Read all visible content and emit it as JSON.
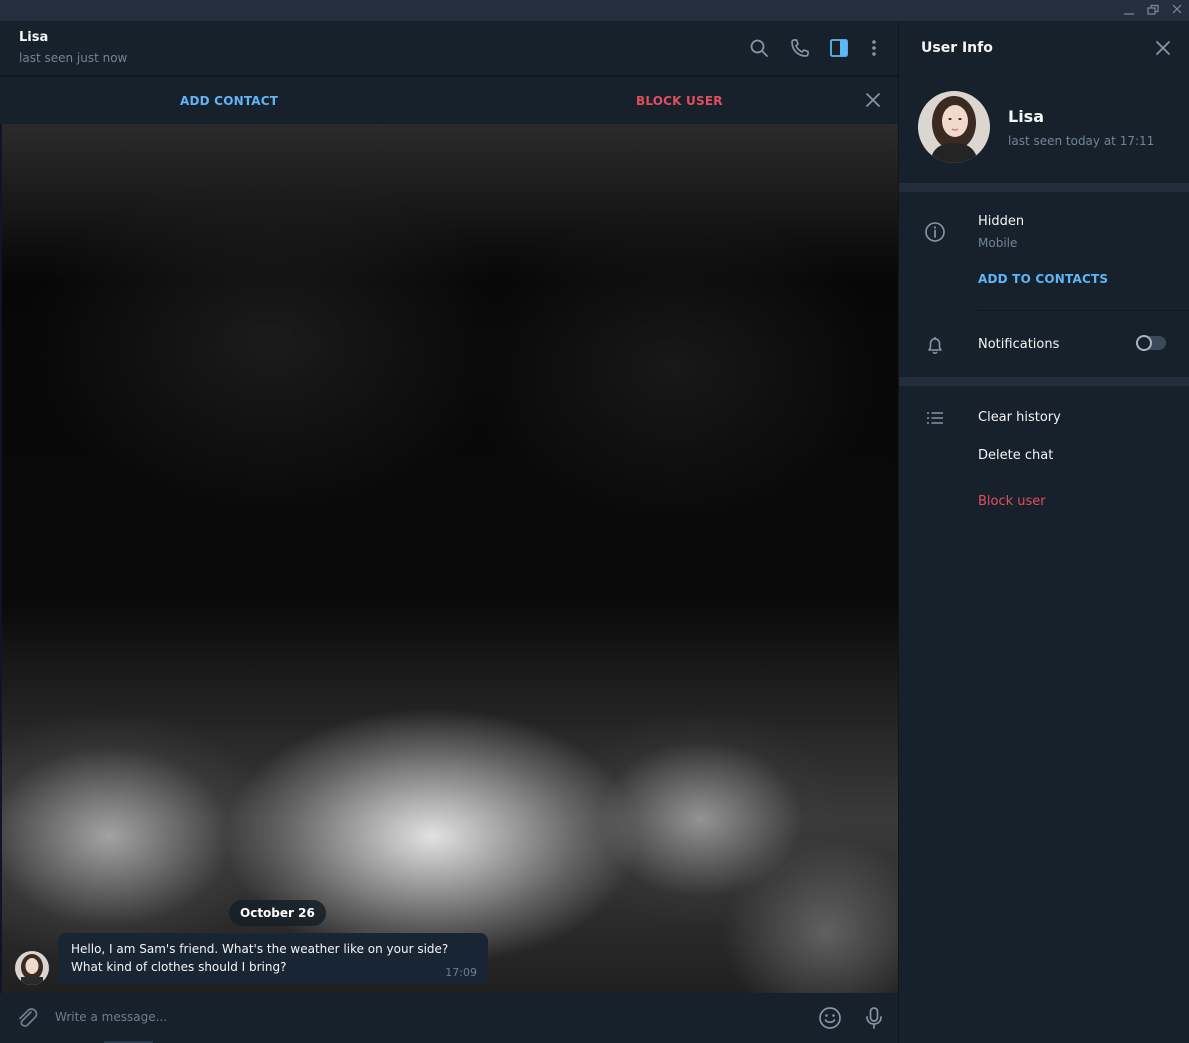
{
  "window": {
    "controls": [
      "minimize-icon",
      "restore-icon",
      "close-icon"
    ]
  },
  "chat": {
    "name": "Lisa",
    "status": "last seen just now",
    "header_icons": [
      "search-icon",
      "phone-icon",
      "sidebar-toggle-icon",
      "more-vertical-icon"
    ],
    "action_bar": {
      "add_contact": "ADD CONTACT",
      "block_user": "BLOCK USER"
    },
    "date_separator": "October 26",
    "messages": [
      {
        "text": "Hello, I am Sam's friend. What's the weather like on your side? What kind of clothes should I bring?",
        "time": "17:09"
      }
    ],
    "composer": {
      "placeholder": "Write a message..."
    }
  },
  "user_info": {
    "title": "User Info",
    "name": "Lisa",
    "status": "last seen today at 17:11",
    "phone_value": "Hidden",
    "phone_label": "Mobile",
    "add_to_contacts": "ADD TO CONTACTS",
    "notifications_label": "Notifications",
    "notifications_enabled": false,
    "clear_history": "Clear history",
    "delete_chat": "Delete chat",
    "block_user": "Block user"
  },
  "colors": {
    "accent": "#5eb5f7",
    "danger": "#e0505c",
    "panel_bg": "#17212b",
    "bubble_bg": "#182533"
  }
}
